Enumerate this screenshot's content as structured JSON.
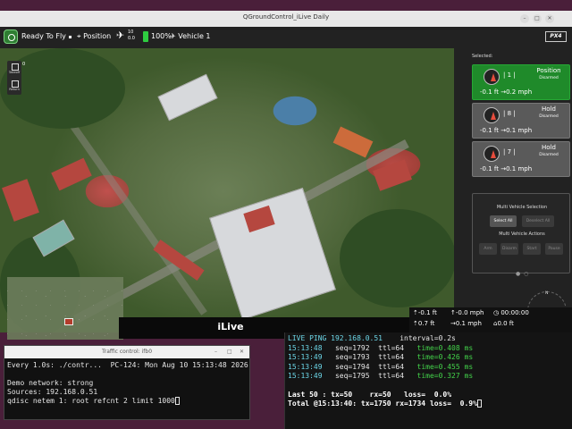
{
  "qgc": {
    "title": "QGroundControl_iLive Daily",
    "toolbar": {
      "status": "Ready To Fly",
      "gps_label": "Position",
      "sat_count": "10",
      "sat_hdop": "0.0",
      "battery": "100%",
      "vehicle": "Vehicle 1",
      "brand": "PX4"
    },
    "tools": [
      {
        "label": "Takeoff"
      },
      {
        "label": "Return"
      }
    ],
    "zero_label": "0",
    "video_caption": "iLive",
    "selected_label": "Selected:",
    "vehicles": [
      {
        "id": "| 1 |",
        "mode": "Position",
        "arm": "Disarmed",
        "alt": "-0.1 ft",
        "speed": "0.2 mph",
        "active": true
      },
      {
        "id": "| 8 |",
        "mode": "Hold",
        "arm": "Disarmed",
        "alt": "-0.1 ft",
        "speed": "0.1 mph",
        "active": false
      },
      {
        "id": "| 7 |",
        "mode": "Hold",
        "arm": "Disarmed",
        "alt": "-0.1 ft",
        "speed": "0.1 mph",
        "active": false
      }
    ],
    "multi": {
      "selection_title": "Multi Vehicle Selection",
      "select_all": "Select All",
      "deselect_all": "Deselect All",
      "actions_title": "Multi Vehicle Actions",
      "actions": [
        "Arm",
        "Disarm",
        "Start",
        "Pause"
      ]
    },
    "compass": {
      "n": "N",
      "e": "E",
      "s": "S",
      "w": "W",
      "heading": "85°"
    },
    "telemetry": {
      "alt_rel": "-0.1 ft",
      "vspeed": "-0.0 mph",
      "time": "00:00:00",
      "alt_amsl": "0.7 ft",
      "hspeed": "0.1 mph",
      "dist": "0.0 ft"
    }
  },
  "traffic_control": {
    "title": "Traffic control: ifb0",
    "lines": [
      "Every 1.0s: ./contr...  PC-124: Mon Aug 10 15:13:48 2026",
      "",
      "Demo network: strong",
      "Sources: 192.168.0.51",
      "qdisc netem 1: root refcnt 2 limit 1000"
    ]
  },
  "ping": {
    "header_cmd": "LIVE PING 192.168.0.51",
    "interval": "interval=0.2s",
    "rows": [
      {
        "t": "15:13:48",
        "seq": "seq=1792",
        "ttl": "ttl=64",
        "time": "time=0.408 ms"
      },
      {
        "t": "15:13:49",
        "seq": "seq=1793",
        "ttl": "ttl=64",
        "time": "time=0.426 ms"
      },
      {
        "t": "15:13:49",
        "seq": "seq=1794",
        "ttl": "ttl=64",
        "time": "time=0.455 ms"
      },
      {
        "t": "15:13:49",
        "seq": "seq=1795",
        "ttl": "ttl=64",
        "time": "time=0.327 ms"
      }
    ],
    "last": "Last 50 : tx=50    rx=50   loss=  0.0%",
    "total": "Total @15:13:40: tx=1750 rx=1734 loss=  0.9%"
  }
}
